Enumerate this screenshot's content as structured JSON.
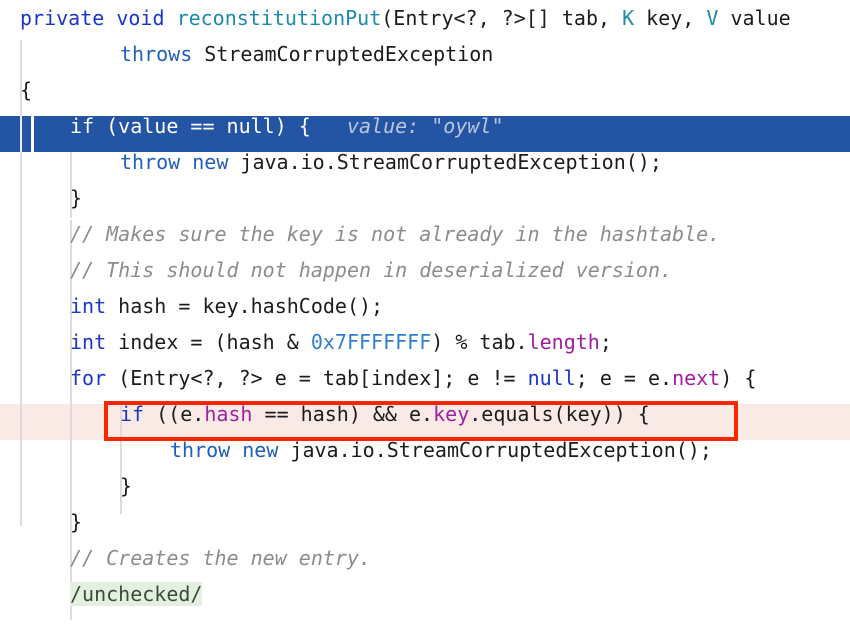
{
  "editor": {
    "language": "java",
    "font_size_px": 20,
    "line_height_px": 36,
    "colors": {
      "background": "#ffffff",
      "selection": "#2455a4",
      "selection_text": "#ffffff",
      "error_row": "#faeae6",
      "annotation_box": "#fa2600",
      "keyword": "#1a35c8",
      "type": "#1c8ca8",
      "field": "#a020a0",
      "number": "#2f80d0",
      "comment": "#8c8c8c",
      "inline_hint": "#b9c6dd",
      "green_highlight": "#e3f0e0",
      "indent_guide": "#dcdcdc"
    }
  },
  "inline_hint": {
    "label": "value: \"oywl\""
  },
  "annotation": {
    "box_label": "if ((e.hash == hash) && e.key.equals(key)) {"
  },
  "lines": [
    {
      "index": 0,
      "indent": 0,
      "state": "normal",
      "text": "private void reconstitutionPut(Entry<?, ?>[] tab, K key, V value",
      "tokens": [
        {
          "t": "private",
          "c": "kw"
        },
        {
          "t": " ",
          "c": "plain"
        },
        {
          "t": "void",
          "c": "kw"
        },
        {
          "t": " ",
          "c": "plain"
        },
        {
          "t": "reconstitutionPut",
          "c": "type"
        },
        {
          "t": "(Entry<?, ?>[] tab, ",
          "c": "plain"
        },
        {
          "t": "K",
          "c": "type"
        },
        {
          "t": " key, ",
          "c": "plain"
        },
        {
          "t": "V",
          "c": "type"
        },
        {
          "t": " value",
          "c": "plain"
        }
      ]
    },
    {
      "index": 1,
      "indent": 2,
      "state": "normal",
      "text": "throws StreamCorruptedException",
      "tokens": [
        {
          "t": "throws",
          "c": "kw2"
        },
        {
          "t": " StreamCorruptedException",
          "c": "plain"
        }
      ]
    },
    {
      "index": 2,
      "indent": 0,
      "state": "normal",
      "text": "{",
      "tokens": [
        {
          "t": "{",
          "c": "plain"
        }
      ]
    },
    {
      "index": 3,
      "indent": 1,
      "state": "selected",
      "text": "if (value == null) {",
      "hint": "value: \"oywl\"",
      "tokens": [
        {
          "t": "if (value == null) {",
          "c": "sel-text"
        }
      ]
    },
    {
      "index": 4,
      "indent": 2,
      "state": "normal",
      "text": "throw new java.io.StreamCorruptedException();",
      "tokens": [
        {
          "t": "throw",
          "c": "kw2"
        },
        {
          "t": " ",
          "c": "plain"
        },
        {
          "t": "new",
          "c": "kw2"
        },
        {
          "t": " java.io.StreamCorruptedException();",
          "c": "plain"
        }
      ]
    },
    {
      "index": 5,
      "indent": 1,
      "state": "normal",
      "text": "}",
      "tokens": [
        {
          "t": "}",
          "c": "plain"
        }
      ]
    },
    {
      "index": 6,
      "indent": 1,
      "state": "normal",
      "text": "// Makes sure the key is not already in the hashtable.",
      "tokens": [
        {
          "t": "// Makes sure the key is not already in the hashtable.",
          "c": "cmt"
        }
      ]
    },
    {
      "index": 7,
      "indent": 1,
      "state": "normal",
      "text": "// This should not happen in deserialized version.",
      "tokens": [
        {
          "t": "// This should not happen in deserialized version.",
          "c": "cmt"
        }
      ]
    },
    {
      "index": 8,
      "indent": 1,
      "state": "normal",
      "text": "int hash = key.hashCode();",
      "tokens": [
        {
          "t": "int",
          "c": "kw"
        },
        {
          "t": " hash = key.hashCode();",
          "c": "plain"
        }
      ]
    },
    {
      "index": 9,
      "indent": 1,
      "state": "normal",
      "text": "int index = (hash & 0x7FFFFFFF) % tab.length;",
      "tokens": [
        {
          "t": "int",
          "c": "kw"
        },
        {
          "t": " index = (hash & ",
          "c": "plain"
        },
        {
          "t": "0x7FFFFFFF",
          "c": "num"
        },
        {
          "t": ") % tab.",
          "c": "plain"
        },
        {
          "t": "length",
          "c": "fld"
        },
        {
          "t": ";",
          "c": "plain"
        }
      ]
    },
    {
      "index": 10,
      "indent": 1,
      "state": "normal",
      "text": "for (Entry<?, ?> e = tab[index]; e != null; e = e.next) {",
      "tokens": [
        {
          "t": "for",
          "c": "kw"
        },
        {
          "t": " (Entry<?, ?> e = tab[index]; e != ",
          "c": "plain"
        },
        {
          "t": "null",
          "c": "kw"
        },
        {
          "t": "; e = e.",
          "c": "plain"
        },
        {
          "t": "next",
          "c": "fld"
        },
        {
          "t": ") {",
          "c": "plain"
        }
      ]
    },
    {
      "index": 11,
      "indent": 2,
      "state": "error",
      "text": "if ((e.hash == hash) && e.key.equals(key)) {",
      "tokens": [
        {
          "t": "if",
          "c": "kw"
        },
        {
          "t": " ((e.",
          "c": "plain"
        },
        {
          "t": "hash",
          "c": "fld"
        },
        {
          "t": " == hash) && e.",
          "c": "plain"
        },
        {
          "t": "key",
          "c": "fld"
        },
        {
          "t": ".equals(key)) {",
          "c": "plain"
        }
      ]
    },
    {
      "index": 12,
      "indent": 3,
      "state": "normal",
      "text": "throw new java.io.StreamCorruptedException();",
      "tokens": [
        {
          "t": "throw",
          "c": "kw2"
        },
        {
          "t": " ",
          "c": "plain"
        },
        {
          "t": "new",
          "c": "kw2"
        },
        {
          "t": " java.io.StreamCorruptedException();",
          "c": "plain"
        }
      ]
    },
    {
      "index": 13,
      "indent": 2,
      "state": "normal",
      "text": "}",
      "tokens": [
        {
          "t": "}",
          "c": "plain"
        }
      ]
    },
    {
      "index": 14,
      "indent": 1,
      "state": "normal",
      "text": "}",
      "tokens": [
        {
          "t": "}",
          "c": "plain"
        }
      ]
    },
    {
      "index": 15,
      "indent": 1,
      "state": "normal",
      "text": "// Creates the new entry.",
      "tokens": [
        {
          "t": "// Creates the new entry.",
          "c": "cmt"
        }
      ]
    },
    {
      "index": 16,
      "indent": 1,
      "state": "normal",
      "text": "/unchecked/",
      "highlight": "green",
      "tokens": [
        {
          "t": "/unchecked/",
          "c": "hl-green"
        }
      ]
    }
  ]
}
